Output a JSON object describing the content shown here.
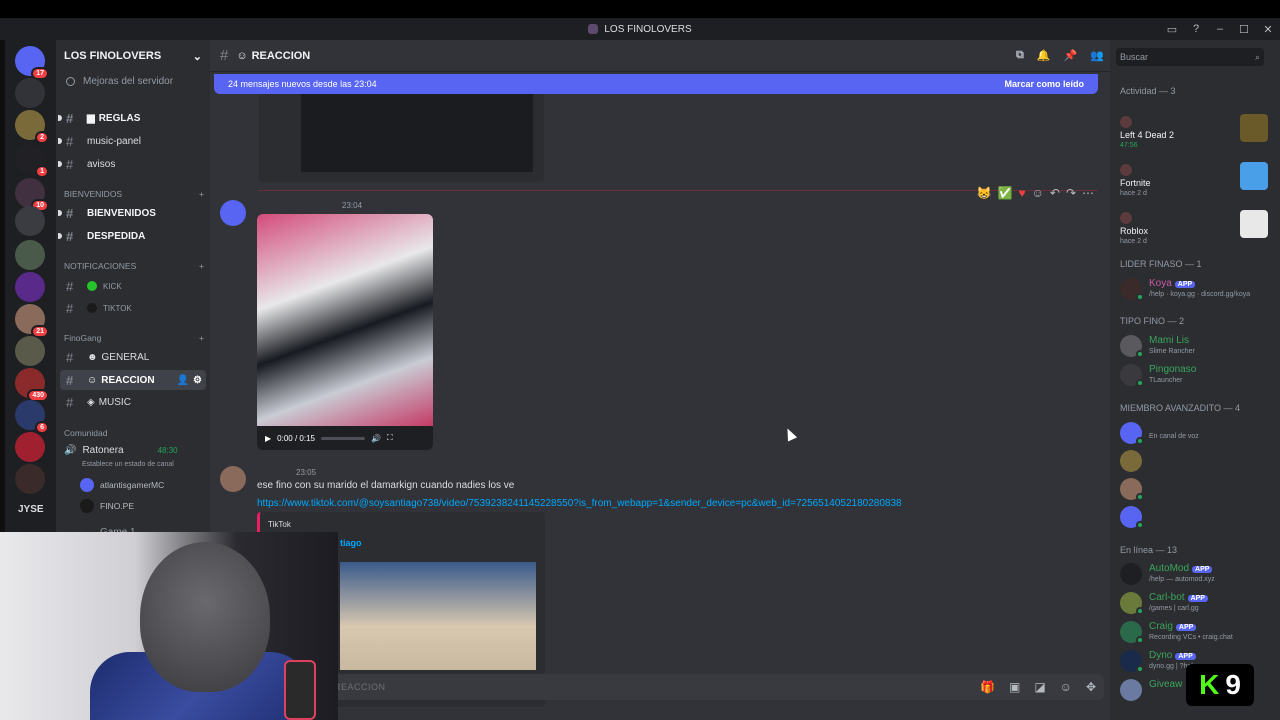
{
  "window": {
    "title": "LOS FINOLOVERS",
    "buttons": [
      "▭",
      "?",
      "–",
      "☐",
      "✕"
    ]
  },
  "rail": {
    "dm_badge": "17",
    "badges": [
      "2",
      "1",
      "10",
      "21",
      "430",
      "6"
    ],
    "label": "JYSE"
  },
  "server": {
    "name": "LOS FINOLOVERS",
    "boosts": "Mejoras del servidor"
  },
  "channels": {
    "reglas": "REGLAS",
    "music_panel": "music-panel",
    "avisos": "avisos",
    "cat_bienvenidos": "BIENVENIDOS",
    "bienvenidos": "BIENVENIDOS",
    "despedida": "DESPEDIDA",
    "cat_notificaciones": "NOTIFICACIONES",
    "kick": "KICK",
    "tiktok": "TIKTOK",
    "cat_finogang": "FinoGang",
    "general": "GENERAL",
    "reaccion": "REACCION",
    "music": "MUSIC",
    "cat_comunidad": "Comunidad"
  },
  "voice": {
    "channel": "Ratonera",
    "time": "48:30",
    "status": "Establece un estado de canal",
    "users": [
      "atlantisgamerMC",
      "FINO.PE"
    ],
    "next": "Game 1"
  },
  "chat": {
    "channel": "REACCION",
    "new_messages": "24 mensajes nuevos desde las 23:04",
    "mark_read": "Marcar como leído",
    "msg1_time": "23:04",
    "video_time": "0:00 / 0:15",
    "msg2_time": "23:05",
    "msg2_text": "ese fino con su marido el damarkign cuando nadies los ve",
    "msg2_link": "https://www.tiktok.com/@soysantiago738/video/7539238241145228550?is_from_webapp=1&sender_device=pc&web_id=7256514052180280838",
    "embed_provider": "TikTok",
    "embed_author": "tiago",
    "composer_placeholder": "REACCION"
  },
  "members": {
    "search": "Buscar",
    "activity_header": "Actividad — 3",
    "activities": [
      {
        "title": "Left 4 Dead 2",
        "sub": "47:56"
      },
      {
        "title": "Fortnite",
        "sub": "hace 2 d"
      },
      {
        "title": "Roblox",
        "sub": "hace 2 d"
      }
    ],
    "lider_header": "LIDER FINASO — 1",
    "koya": {
      "name": "Koya",
      "tag": "APP",
      "desc": "/help · koya.gg · discord.gg/koya"
    },
    "tipo_header": "TIPO FINO — 2",
    "tipo": [
      {
        "name": "Mami Lis",
        "desc": "Slime Rancher"
      },
      {
        "name": "Pingonaso",
        "desc": "TLauncher"
      }
    ],
    "avanzado_header": "MIEMBRO AVANZADITO — 4",
    "avanzado_voice": "En canal de voz",
    "online_header": "En línea — 13",
    "online": [
      {
        "name": "AutoMod",
        "tag": "APP",
        "desc": "/help — automod.xyz"
      },
      {
        "name": "Carl-bot",
        "tag": "APP",
        "desc": "/games | carl.gg"
      },
      {
        "name": "Craig",
        "tag": "APP",
        "desc": "Recording VCs • craig.chat"
      },
      {
        "name": "Dyno",
        "tag": "APP",
        "desc": "dyno.gg | ?help"
      },
      {
        "name": "Giveaw",
        "tag": "",
        "desc": ""
      }
    ]
  },
  "overlay": {
    "kick_logo": "K",
    "kick_number": "9"
  },
  "colors": {
    "accent": "#5865f2",
    "online": "#23a55a",
    "link": "#00a8fc",
    "kick": "#53fc18"
  }
}
